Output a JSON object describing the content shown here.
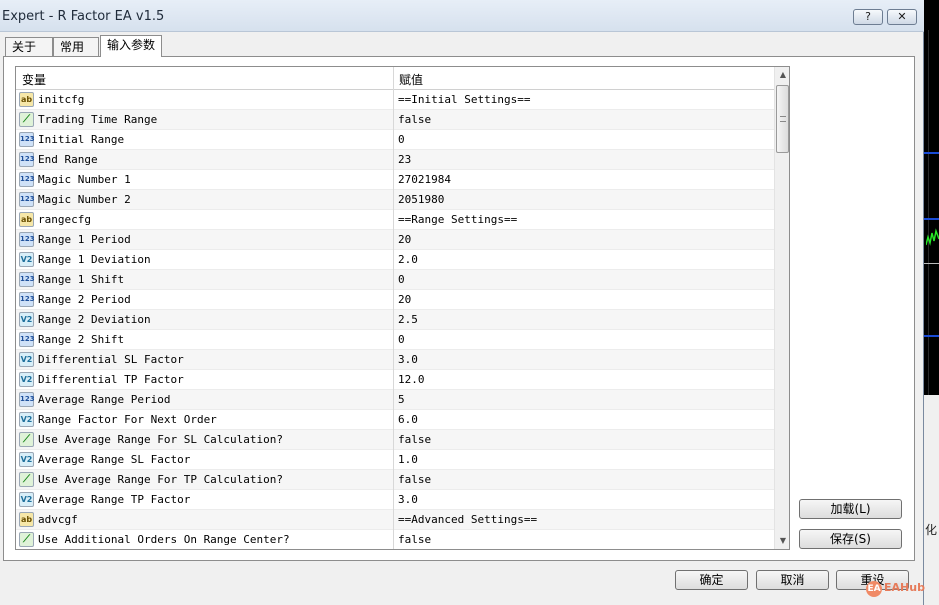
{
  "window": {
    "title": "Expert - R Factor EA v1.5",
    "help_label": "?",
    "close_label": "✕"
  },
  "tabs": [
    {
      "label": "关于"
    },
    {
      "label": "常用"
    },
    {
      "label": "输入参数",
      "active": true
    }
  ],
  "table": {
    "headers": {
      "variable": "变量",
      "value": "赋值"
    },
    "rows": [
      {
        "type": "ab",
        "icon_text": "ab",
        "name": "initcfg",
        "value": "==Initial Settings=="
      },
      {
        "type": "bool",
        "icon_text": "⟋",
        "name": "Trading Time Range",
        "value": "false"
      },
      {
        "type": "int",
        "icon_text": "123",
        "name": "Initial Range",
        "value": "0"
      },
      {
        "type": "int",
        "icon_text": "123",
        "name": "End Range",
        "value": "23"
      },
      {
        "type": "int",
        "icon_text": "123",
        "name": "Magic Number 1",
        "value": "27021984"
      },
      {
        "type": "int",
        "icon_text": "123",
        "name": "Magic Number 2",
        "value": "2051980"
      },
      {
        "type": "ab",
        "icon_text": "ab",
        "name": "rangecfg",
        "value": "==Range Settings=="
      },
      {
        "type": "int",
        "icon_text": "123",
        "name": "Range 1 Period",
        "value": "20"
      },
      {
        "type": "dbl",
        "icon_text": "V2",
        "name": "Range 1 Deviation",
        "value": "2.0"
      },
      {
        "type": "int",
        "icon_text": "123",
        "name": "Range 1 Shift",
        "value": "0"
      },
      {
        "type": "int",
        "icon_text": "123",
        "name": "Range 2 Period",
        "value": "20"
      },
      {
        "type": "dbl",
        "icon_text": "V2",
        "name": "Range 2 Deviation",
        "value": "2.5"
      },
      {
        "type": "int",
        "icon_text": "123",
        "name": "Range 2 Shift",
        "value": "0"
      },
      {
        "type": "dbl",
        "icon_text": "V2",
        "name": "Differential SL Factor",
        "value": "3.0"
      },
      {
        "type": "dbl",
        "icon_text": "V2",
        "name": "Differential TP Factor",
        "value": "12.0"
      },
      {
        "type": "int",
        "icon_text": "123",
        "name": "Average Range Period",
        "value": "5"
      },
      {
        "type": "dbl",
        "icon_text": "V2",
        "name": "Range Factor For Next Order",
        "value": "6.0"
      },
      {
        "type": "bool",
        "icon_text": "⟋",
        "name": "Use Average Range For SL Calculation?",
        "value": "false"
      },
      {
        "type": "dbl",
        "icon_text": "V2",
        "name": "Average Range SL Factor",
        "value": "1.0"
      },
      {
        "type": "bool",
        "icon_text": "⟋",
        "name": "Use Average Range For TP Calculation?",
        "value": "false"
      },
      {
        "type": "dbl",
        "icon_text": "V2",
        "name": "Average Range TP Factor",
        "value": "3.0"
      },
      {
        "type": "ab",
        "icon_text": "ab",
        "name": "advcgf",
        "value": "==Advanced Settings=="
      },
      {
        "type": "bool",
        "icon_text": "⟋",
        "name": "Use Additional Orders On Range Center?",
        "value": "false"
      }
    ]
  },
  "side_buttons": {
    "load": "加载(L)",
    "save": "保存(S)"
  },
  "footer_buttons": {
    "ok": "确定",
    "cancel": "取消",
    "reset": "重设"
  },
  "watermark": {
    "logo_text": "EA",
    "text": "EAHub"
  },
  "background": {
    "hua_char": "化"
  }
}
